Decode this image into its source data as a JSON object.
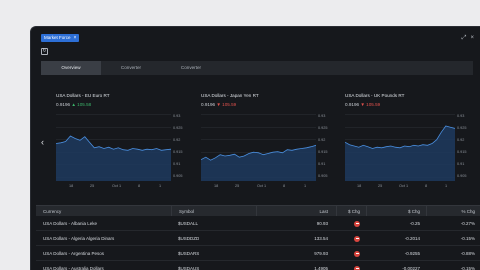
{
  "window": {
    "title": "Market Force",
    "close_glyph": "×",
    "controls": [
      "⤢",
      "×"
    ]
  },
  "toolbar": {
    "refresh_icon": "refresh-icon",
    "refresh_glyph": "↻"
  },
  "tabs": [
    {
      "label": "Overview",
      "active": true
    },
    {
      "label": "Converter",
      "active": false
    },
    {
      "label": "Converter",
      "active": false
    }
  ],
  "nav": {
    "prev_glyph": "‹"
  },
  "charts": [
    {
      "title": "USA Dollars - EU Euro RT",
      "price": "0.9196",
      "arrow": "▲",
      "change": "105.58",
      "direction": "up",
      "y_ticks": [
        "0.93",
        "0.925",
        "0.92",
        "0.915",
        "0.91",
        "0.905"
      ],
      "x_ticks": [
        "18",
        "25",
        "Oct 1",
        "8",
        "1"
      ],
      "values": [
        0.9185,
        0.9188,
        0.9193,
        0.9215,
        0.9205,
        0.9198,
        0.9212,
        0.919,
        0.9168,
        0.9172,
        0.9165,
        0.917,
        0.9162,
        0.9168,
        0.916,
        0.9158,
        0.9165,
        0.9162,
        0.9158,
        0.9162,
        0.916,
        0.9165,
        0.9158,
        0.916,
        0.9162
      ]
    },
    {
      "title": "USA Dollars - Japan Yen RT",
      "price": "0.9196",
      "arrow": "▼",
      "change": "105.59",
      "direction": "down",
      "y_ticks": [
        "0.93",
        "0.925",
        "0.92",
        "0.915",
        "0.91",
        "0.905"
      ],
      "x_ticks": [
        "18",
        "25",
        "Oct 1",
        "8",
        "1"
      ],
      "values": [
        0.912,
        0.913,
        0.9118,
        0.9128,
        0.914,
        0.9135,
        0.9138,
        0.9142,
        0.913,
        0.9135,
        0.9145,
        0.915,
        0.9148,
        0.914,
        0.9145,
        0.915,
        0.9152,
        0.9148,
        0.916,
        0.9158,
        0.9162,
        0.9165,
        0.9168,
        0.9172,
        0.9178
      ]
    },
    {
      "title": "USA Dollars - UK Pounds RT",
      "price": "0.9196",
      "arrow": "▼",
      "change": "105.59",
      "direction": "down",
      "y_ticks": [
        "0.93",
        "0.925",
        "0.92",
        "0.915",
        "0.91",
        "0.905"
      ],
      "x_ticks": [
        "18",
        "25",
        "Oct 1",
        "8",
        "1"
      ],
      "values": [
        0.919,
        0.918,
        0.9175,
        0.917,
        0.9178,
        0.9172,
        0.9165,
        0.917,
        0.9168,
        0.9172,
        0.9175,
        0.917,
        0.9168,
        0.9175,
        0.9172,
        0.9178,
        0.9175,
        0.918,
        0.9178,
        0.9185,
        0.92,
        0.923,
        0.9255,
        0.925,
        0.9245
      ]
    }
  ],
  "table": {
    "headers": {
      "currency": "Currency",
      "symbol": "Symbol",
      "last": "Last",
      "dchg": "$ Chg",
      "chg": "$ Chg",
      "pchg": "% Chg"
    },
    "rows": [
      {
        "currency": "USA Dollars - Albania Leke",
        "symbol": "$USDALL",
        "last": "90.93",
        "chg": "-0.25",
        "pchg": "-0.27%"
      },
      {
        "currency": "USA Dollars - Algeria Algeria Dinars",
        "symbol": "$USDDZD",
        "last": "133.54",
        "chg": "-0.2014",
        "pchg": "-0.15%"
      },
      {
        "currency": "USA Dollars - Argentina Pesos",
        "symbol": "$USDARS",
        "last": "979.93",
        "chg": "-0.9255",
        "pchg": "-0.88%"
      },
      {
        "currency": "USA Dollars - Australia Dollars",
        "symbol": "$USDAUS",
        "last": "1.4905",
        "chg": "-0.00227",
        "pchg": "-0.15%"
      }
    ]
  }
}
